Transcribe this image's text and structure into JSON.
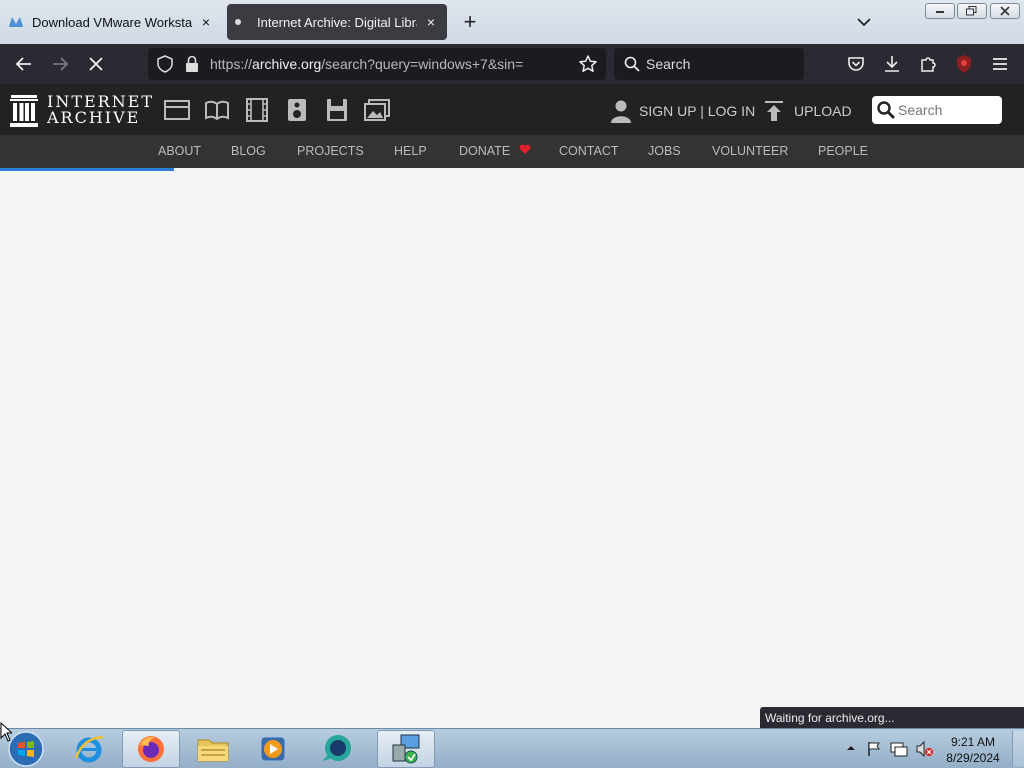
{
  "browser": {
    "tabs": [
      {
        "title": "Download VMware Workstation",
        "icon": "vmware-favicon"
      },
      {
        "title": "Internet Archive: Digital Library",
        "icon": "loading-dot"
      }
    ],
    "new_tab_label": "+",
    "tab_close_label": "×",
    "url": {
      "prefix": "https://",
      "host": "archive.org",
      "path": "/search?query=windows+7&sin="
    },
    "search_placeholder": "Search",
    "status_text": "Waiting for archive.org..."
  },
  "archive": {
    "logo_line1": "INTERNET",
    "logo_line2": "ARCHIVE",
    "media_icons": [
      "web-icon",
      "texts-icon",
      "video-icon",
      "audio-icon",
      "software-icon",
      "images-icon"
    ],
    "signup_label": "SIGN UP | LOG IN",
    "upload_label": "UPLOAD",
    "search_placeholder": "Search",
    "nav": [
      "ABOUT",
      "BLOG",
      "PROJECTS",
      "HELP",
      "DONATE",
      "CONTACT",
      "JOBS",
      "VOLUNTEER",
      "PEOPLE"
    ],
    "donate_heart_color": "#e0202a",
    "loading_progress_fraction": 0.17
  },
  "taskbar": {
    "apps": [
      "internet-explorer-icon",
      "firefox-icon",
      "file-explorer-icon",
      "media-player-icon",
      "chat-app-icon",
      "network-setup-icon"
    ],
    "active_apps": [
      "firefox-icon",
      "network-setup-icon"
    ],
    "time": "9:21 AM",
    "date": "8/29/2024"
  }
}
